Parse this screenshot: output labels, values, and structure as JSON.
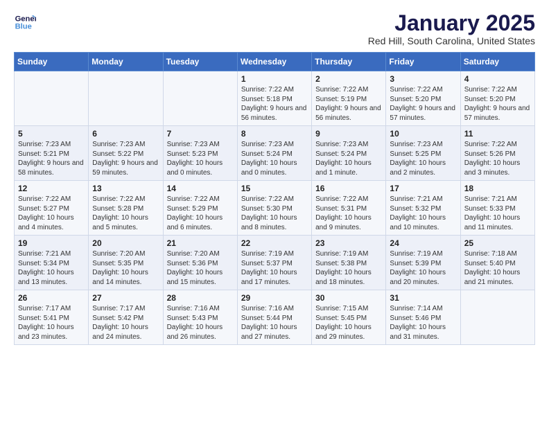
{
  "logo": {
    "line1": "General",
    "line2": "Blue"
  },
  "title": "January 2025",
  "subtitle": "Red Hill, South Carolina, United States",
  "days_of_week": [
    "Sunday",
    "Monday",
    "Tuesday",
    "Wednesday",
    "Thursday",
    "Friday",
    "Saturday"
  ],
  "weeks": [
    [
      {
        "day": "",
        "info": ""
      },
      {
        "day": "",
        "info": ""
      },
      {
        "day": "",
        "info": ""
      },
      {
        "day": "1",
        "info": "Sunrise: 7:22 AM\nSunset: 5:18 PM\nDaylight: 9 hours and 56 minutes."
      },
      {
        "day": "2",
        "info": "Sunrise: 7:22 AM\nSunset: 5:19 PM\nDaylight: 9 hours and 56 minutes."
      },
      {
        "day": "3",
        "info": "Sunrise: 7:22 AM\nSunset: 5:20 PM\nDaylight: 9 hours and 57 minutes."
      },
      {
        "day": "4",
        "info": "Sunrise: 7:22 AM\nSunset: 5:20 PM\nDaylight: 9 hours and 57 minutes."
      }
    ],
    [
      {
        "day": "5",
        "info": "Sunrise: 7:23 AM\nSunset: 5:21 PM\nDaylight: 9 hours and 58 minutes."
      },
      {
        "day": "6",
        "info": "Sunrise: 7:23 AM\nSunset: 5:22 PM\nDaylight: 9 hours and 59 minutes."
      },
      {
        "day": "7",
        "info": "Sunrise: 7:23 AM\nSunset: 5:23 PM\nDaylight: 10 hours and 0 minutes."
      },
      {
        "day": "8",
        "info": "Sunrise: 7:23 AM\nSunset: 5:24 PM\nDaylight: 10 hours and 0 minutes."
      },
      {
        "day": "9",
        "info": "Sunrise: 7:23 AM\nSunset: 5:24 PM\nDaylight: 10 hours and 1 minute."
      },
      {
        "day": "10",
        "info": "Sunrise: 7:23 AM\nSunset: 5:25 PM\nDaylight: 10 hours and 2 minutes."
      },
      {
        "day": "11",
        "info": "Sunrise: 7:22 AM\nSunset: 5:26 PM\nDaylight: 10 hours and 3 minutes."
      }
    ],
    [
      {
        "day": "12",
        "info": "Sunrise: 7:22 AM\nSunset: 5:27 PM\nDaylight: 10 hours and 4 minutes."
      },
      {
        "day": "13",
        "info": "Sunrise: 7:22 AM\nSunset: 5:28 PM\nDaylight: 10 hours and 5 minutes."
      },
      {
        "day": "14",
        "info": "Sunrise: 7:22 AM\nSunset: 5:29 PM\nDaylight: 10 hours and 6 minutes."
      },
      {
        "day": "15",
        "info": "Sunrise: 7:22 AM\nSunset: 5:30 PM\nDaylight: 10 hours and 8 minutes."
      },
      {
        "day": "16",
        "info": "Sunrise: 7:22 AM\nSunset: 5:31 PM\nDaylight: 10 hours and 9 minutes."
      },
      {
        "day": "17",
        "info": "Sunrise: 7:21 AM\nSunset: 5:32 PM\nDaylight: 10 hours and 10 minutes."
      },
      {
        "day": "18",
        "info": "Sunrise: 7:21 AM\nSunset: 5:33 PM\nDaylight: 10 hours and 11 minutes."
      }
    ],
    [
      {
        "day": "19",
        "info": "Sunrise: 7:21 AM\nSunset: 5:34 PM\nDaylight: 10 hours and 13 minutes."
      },
      {
        "day": "20",
        "info": "Sunrise: 7:20 AM\nSunset: 5:35 PM\nDaylight: 10 hours and 14 minutes."
      },
      {
        "day": "21",
        "info": "Sunrise: 7:20 AM\nSunset: 5:36 PM\nDaylight: 10 hours and 15 minutes."
      },
      {
        "day": "22",
        "info": "Sunrise: 7:19 AM\nSunset: 5:37 PM\nDaylight: 10 hours and 17 minutes."
      },
      {
        "day": "23",
        "info": "Sunrise: 7:19 AM\nSunset: 5:38 PM\nDaylight: 10 hours and 18 minutes."
      },
      {
        "day": "24",
        "info": "Sunrise: 7:19 AM\nSunset: 5:39 PM\nDaylight: 10 hours and 20 minutes."
      },
      {
        "day": "25",
        "info": "Sunrise: 7:18 AM\nSunset: 5:40 PM\nDaylight: 10 hours and 21 minutes."
      }
    ],
    [
      {
        "day": "26",
        "info": "Sunrise: 7:17 AM\nSunset: 5:41 PM\nDaylight: 10 hours and 23 minutes."
      },
      {
        "day": "27",
        "info": "Sunrise: 7:17 AM\nSunset: 5:42 PM\nDaylight: 10 hours and 24 minutes."
      },
      {
        "day": "28",
        "info": "Sunrise: 7:16 AM\nSunset: 5:43 PM\nDaylight: 10 hours and 26 minutes."
      },
      {
        "day": "29",
        "info": "Sunrise: 7:16 AM\nSunset: 5:44 PM\nDaylight: 10 hours and 27 minutes."
      },
      {
        "day": "30",
        "info": "Sunrise: 7:15 AM\nSunset: 5:45 PM\nDaylight: 10 hours and 29 minutes."
      },
      {
        "day": "31",
        "info": "Sunrise: 7:14 AM\nSunset: 5:46 PM\nDaylight: 10 hours and 31 minutes."
      },
      {
        "day": "",
        "info": ""
      }
    ]
  ]
}
